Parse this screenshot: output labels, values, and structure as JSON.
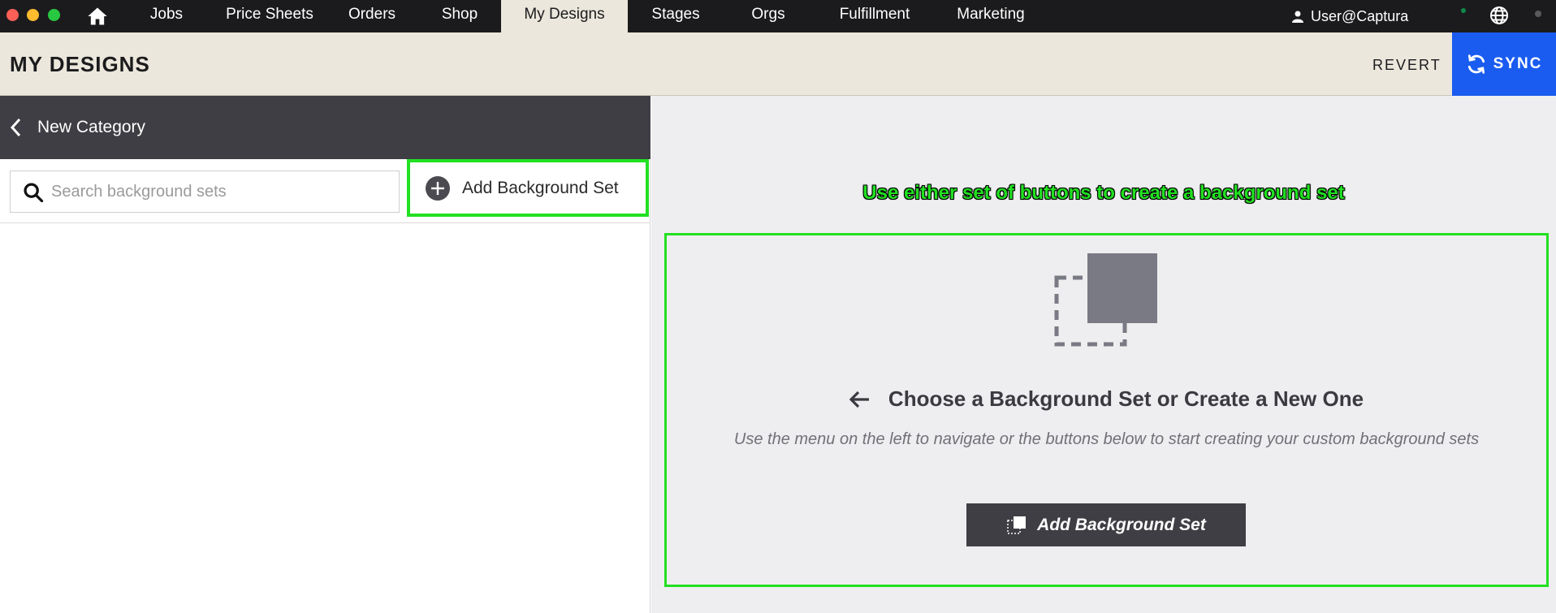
{
  "nav": {
    "items": [
      {
        "label": "Jobs",
        "active": false
      },
      {
        "label": "Price Sheets",
        "active": false
      },
      {
        "label": "Orders",
        "active": false
      },
      {
        "label": "Shop",
        "active": false
      },
      {
        "label": "My Designs",
        "active": true
      },
      {
        "label": "Stages",
        "active": false
      },
      {
        "label": "Orgs",
        "active": false
      },
      {
        "label": "Fulfillment",
        "active": false
      },
      {
        "label": "Marketing",
        "active": false
      }
    ],
    "user": "User@Captura",
    "icons": [
      "home-icon",
      "user-icon",
      "globe-icon"
    ]
  },
  "header": {
    "title": "MY DESIGNS",
    "revert_label": "REVERT",
    "sync_label": "SYNC"
  },
  "left_panel": {
    "category_title": "New Category",
    "search_placeholder": "Search background sets",
    "add_button_label": "Add Background Set"
  },
  "right_panel": {
    "annotation": "Use either set of buttons to create a background set",
    "empty_title": "Choose a Background Set or Create a New One",
    "empty_subtitle": "Use the menu on the left to navigate or the buttons below to start creating your custom background sets",
    "add_button_label": "Add Background Set"
  },
  "colors": {
    "nav_bg": "#1b1b1d",
    "header_bg": "#ebe7dc",
    "sync_blue": "#1a5cf0",
    "dark_panel": "#3e3e44",
    "highlight_green": "#22e022"
  }
}
